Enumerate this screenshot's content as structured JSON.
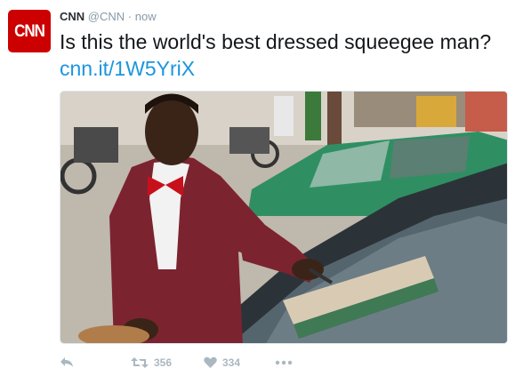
{
  "account": {
    "avatar_text": "CNN",
    "name": "CNN",
    "handle": "@CNN",
    "separator": "·",
    "time": "now",
    "brand_color": "#cc0000"
  },
  "tweet": {
    "text": "Is this the world's best dressed squeegee man?",
    "link": "cnn.it/1W5YriX"
  },
  "media": {
    "description_icon": "photo"
  },
  "actions": {
    "reply_icon": "reply-icon",
    "retweet_icon": "retweet-icon",
    "retweet_count": "356",
    "like_icon": "heart-icon",
    "like_count": "334",
    "more_icon": "more-icon"
  },
  "colors": {
    "link": "#1b95e0",
    "muted": "#8899a6",
    "icon": "#aab8c2"
  }
}
